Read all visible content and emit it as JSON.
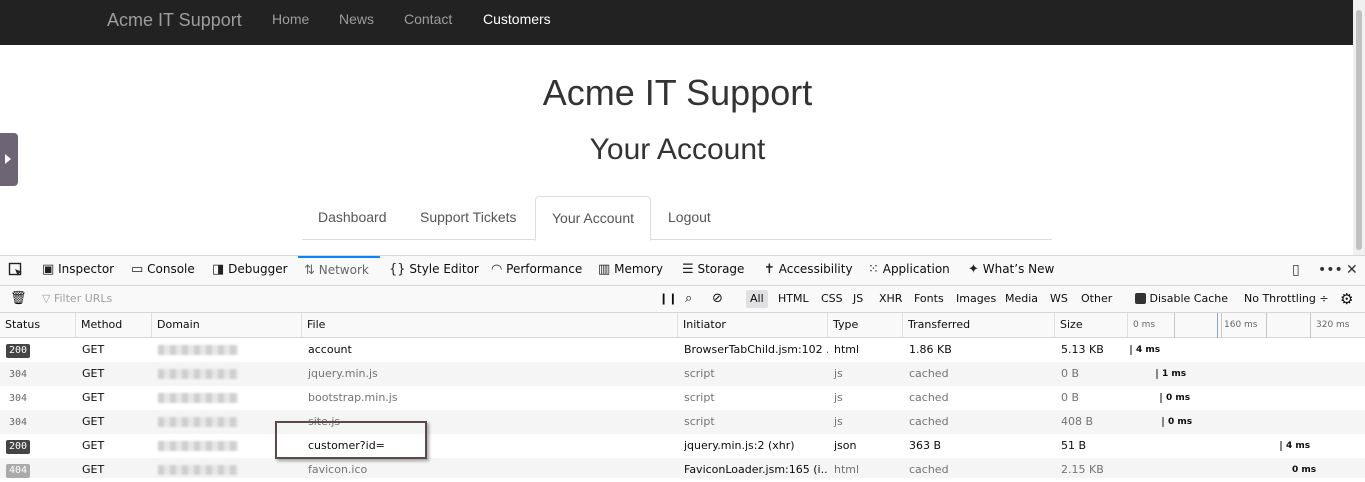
{
  "navbar": {
    "brand": "Acme IT Support",
    "links": [
      "Home",
      "News",
      "Contact",
      "Customers"
    ],
    "active": "Customers"
  },
  "page": {
    "title": "Acme IT Support",
    "subtitle": "Your Account",
    "tabs": [
      "Dashboard",
      "Support Tickets",
      "Your Account",
      "Logout"
    ],
    "active_tab": "Your Account"
  },
  "devtools": {
    "tabs": [
      {
        "label": "Inspector",
        "icon": "inspector-icon"
      },
      {
        "label": "Console",
        "icon": "console-icon"
      },
      {
        "label": "Debugger",
        "icon": "debugger-icon"
      },
      {
        "label": "Network",
        "icon": "network-icon"
      },
      {
        "label": "Style Editor",
        "icon": "style-editor-icon"
      },
      {
        "label": "Performance",
        "icon": "performance-icon"
      },
      {
        "label": "Memory",
        "icon": "memory-icon"
      },
      {
        "label": "Storage",
        "icon": "storage-icon"
      },
      {
        "label": "Accessibility",
        "icon": "accessibility-icon"
      },
      {
        "label": "Application",
        "icon": "application-icon"
      },
      {
        "label": "What’s New",
        "icon": "whats-new-icon"
      }
    ],
    "selected_tab": "Network",
    "filter_placeholder": "Filter URLs",
    "type_filters": [
      "All",
      "HTML",
      "CSS",
      "JS",
      "XHR",
      "Fonts",
      "Images",
      "Media",
      "WS",
      "Other"
    ],
    "selected_filter": "All",
    "disable_cache": "Disable Cache",
    "throttling": "No Throttling ÷",
    "columns": [
      "Status",
      "Method",
      "Domain",
      "File",
      "Initiator",
      "Type",
      "Transferred",
      "Size"
    ],
    "waterfall_ticks": [
      "0 ms",
      "160 ms",
      "320 ms"
    ],
    "requests": [
      {
        "status": "200",
        "method": "GET",
        "file": "account",
        "initiator": "BrowserTabChild.jsm:102 ...",
        "type": "html",
        "transferred": "1.86 KB",
        "size": "5.13 KB",
        "time": "4 ms"
      },
      {
        "status": "304",
        "method": "GET",
        "file": "jquery.min.js",
        "initiator": "script",
        "type": "js",
        "transferred": "cached",
        "size": "0 B",
        "time": "1 ms"
      },
      {
        "status": "304",
        "method": "GET",
        "file": "bootstrap.min.js",
        "initiator": "script",
        "type": "js",
        "transferred": "cached",
        "size": "0 B",
        "time": "0 ms"
      },
      {
        "status": "304",
        "method": "GET",
        "file": "site.js",
        "initiator": "script",
        "type": "js",
        "transferred": "cached",
        "size": "408 B",
        "time": "0 ms"
      },
      {
        "status": "200",
        "method": "GET",
        "file": "customer?id=",
        "initiator": "jquery.min.js:2 (xhr)",
        "type": "json",
        "transferred": "363 B",
        "size": "51 B",
        "time": "4 ms"
      },
      {
        "status": "404",
        "method": "GET",
        "file": "favicon.ico",
        "initiator": "FaviconLoader.jsm:165 (i...",
        "type": "html",
        "transferred": "cached",
        "size": "2.15 KB",
        "time": "0 ms"
      }
    ]
  }
}
